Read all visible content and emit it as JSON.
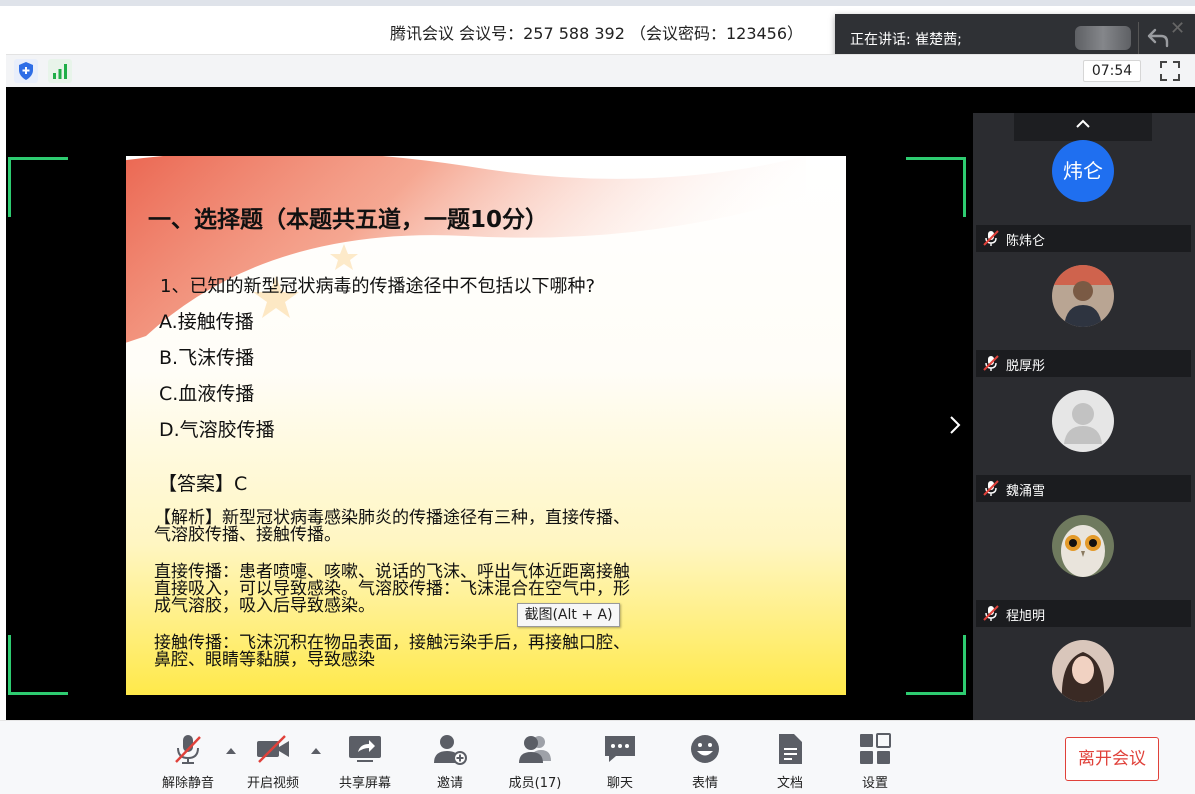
{
  "window": {
    "title": "腾讯会议 会议号：257 588 392 （会议密码：123456）",
    "speaking_label": "正在讲话: 崔楚茜;",
    "timer": "07:54"
  },
  "slide": {
    "title": "一、选择题（本题共五道，一题10分）",
    "question": "1、已知的新型冠状病毒的传播途径中不包括以下哪种?",
    "options": [
      "A.接触传播",
      "B.飞沫传播",
      "C.血液传播",
      "D.气溶胶传播"
    ],
    "answer": "【答案】C",
    "analysis": [
      [
        "【解析】新型冠状病毒感染肺炎的传播途径有三种，直接传播、",
        "气溶胶传播、接触传播。"
      ],
      [
        "直接传播：患者喷嚏、咳嗽、说话的飞沫、呼出气体近距离接触",
        "直接吸入，可以导致感染。气溶胶传播：飞沫混合在空气中，形",
        "成气溶胶，吸入后导致感染。"
      ],
      [
        "接触传播：飞沫沉积在物品表面，接触污染手后，再接触口腔、",
        "鼻腔、眼睛等黏膜，导致感染"
      ]
    ]
  },
  "tooltip": "截图(Alt + A)",
  "participants": [
    {
      "name": "陈炜仑",
      "avatar_text": "炜仑",
      "avatar_color": "#1f6ff0"
    },
    {
      "name": "脱厚彤",
      "avatar_text": "",
      "avatar_color": "#5a4a3f"
    },
    {
      "name": "魏涌雪",
      "avatar_text": "",
      "avatar_color": "#e6e6e6"
    },
    {
      "name": "程旭明",
      "avatar_text": "",
      "avatar_color": "#6f7a5e"
    },
    {
      "name": "",
      "avatar_text": "",
      "avatar_color": "#c9a18f"
    }
  ],
  "toolbar": {
    "unmute": "解除静音",
    "start_video": "开启视频",
    "share_screen": "共享屏幕",
    "invite": "邀请",
    "members": "成员(17)",
    "chat": "聊天",
    "emoji": "表情",
    "docs": "文档",
    "settings": "设置",
    "leave": "离开会议"
  },
  "colors": {
    "accent": "#1f6ff0",
    "danger": "#e0413a",
    "frame": "#2ecc71"
  }
}
